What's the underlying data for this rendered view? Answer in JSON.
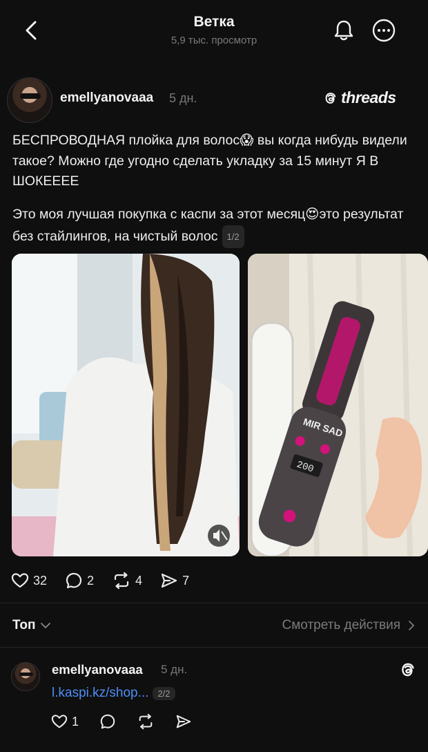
{
  "header": {
    "title": "Ветка",
    "subtitle": "5,9 тыс. просмотр"
  },
  "post": {
    "username": "emellyanovaaa",
    "time": "5 дн.",
    "brand": "threads",
    "paragraph1": "БЕСПРОВОДНАЯ плойка для волос😱 вы когда нибудь видели такое? Можно где угодно сделать укладку за 15 минут Я В ШОКЕЕЕЕ",
    "paragraph2": "Это моя лучшая покупка с каспи за этот месяц😍это результат без стайлингов, на чистый волос",
    "page_counter": "1/2",
    "likes": "32",
    "comments": "2",
    "reposts": "4",
    "shares": "7",
    "device_label": "MIR SAD",
    "device_temp": "200"
  },
  "sort": {
    "label": "Топ",
    "view_actions": "Смотреть действия"
  },
  "reply": {
    "username": "emellyanovaaa",
    "time": "5 дн.",
    "link": "l.kaspi.kz/shop...",
    "page_counter": "2/2",
    "likes": "1"
  },
  "colors": {
    "background": "#0f0f0f",
    "link": "#4d8ff7",
    "muted": "#7b7b7b",
    "divider": "#262626"
  },
  "icons": [
    "back-arrow-icon",
    "bell-icon",
    "more-icon",
    "threads-logo-icon",
    "heart-icon",
    "comment-icon",
    "repost-icon",
    "share-icon",
    "chevron-down-icon",
    "chevron-right-icon",
    "mute-icon"
  ]
}
